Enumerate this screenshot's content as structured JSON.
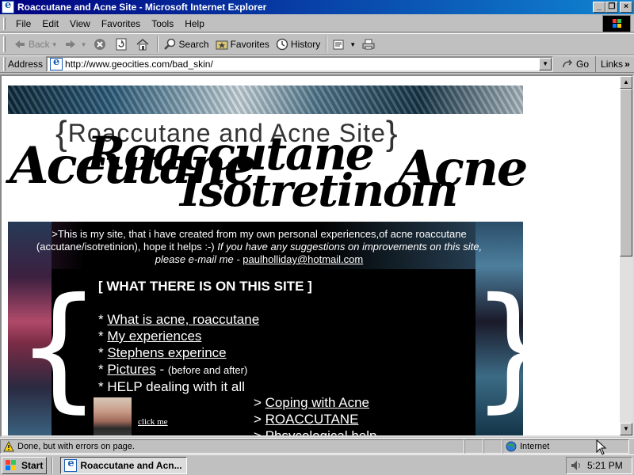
{
  "window": {
    "title": "Roaccutane and Acne Site - Microsoft Internet Explorer",
    "buttons": {
      "minimize": "_",
      "maximize": "❐",
      "close": "×"
    }
  },
  "menubar": {
    "items": [
      {
        "label": "File"
      },
      {
        "label": "Edit"
      },
      {
        "label": "View"
      },
      {
        "label": "Favorites"
      },
      {
        "label": "Tools"
      },
      {
        "label": "Help"
      }
    ]
  },
  "toolbar": {
    "back": "Back",
    "forward": "",
    "search": "Search",
    "favorites": "Favorites",
    "history": "History"
  },
  "address": {
    "label": "Address",
    "url": "http://www.geocities.com/bad_skin/",
    "go": "Go",
    "links": "Links"
  },
  "page": {
    "site_title": "Roaccutane  and  Acne  Site",
    "script_words": {
      "left": "Accutane",
      "center_top": "Roaccutane",
      "center_bottom": "Isotretinoin",
      "right": "Acne"
    },
    "intro": {
      "line1": ">This is my site, that i have created from my own personal experiences,of acne roaccutane",
      "line2_plain": "(accutane/isotretinion),  hope it helps :-) ",
      "line2_italic": "If you have any suggestions on improvements on this site,",
      "line3_italic": "please e-mail me - ",
      "email": "paulholliday@hotmail.com"
    },
    "menu": {
      "heading": "[ WHAT THERE IS ON THIS SITE ]",
      "items": [
        {
          "prefix": "* ",
          "link": "What is acne, roaccutane"
        },
        {
          "prefix": "* ",
          "link": "My experiences"
        },
        {
          "prefix": "* ",
          "link": "Stephens experince"
        },
        {
          "prefix": "* ",
          "link": "Pictures",
          "suffix": " - ",
          "note": "(before and after)"
        },
        {
          "prefix": "* ",
          "text": "HELP dealing with it all"
        }
      ],
      "sub_items": [
        {
          "prefix": "> ",
          "link": "Coping with Acne"
        },
        {
          "prefix": "> ",
          "link": "ROACCUTANE"
        },
        {
          "prefix": "> ",
          "link": "Phsycological help"
        }
      ],
      "click_me": "click me"
    }
  },
  "statusbar": {
    "message": "Done, but with errors on page.",
    "zone": "Internet"
  },
  "taskbar": {
    "start": "Start",
    "task": "Roaccutane and Acn...",
    "time": "5:21 PM"
  }
}
